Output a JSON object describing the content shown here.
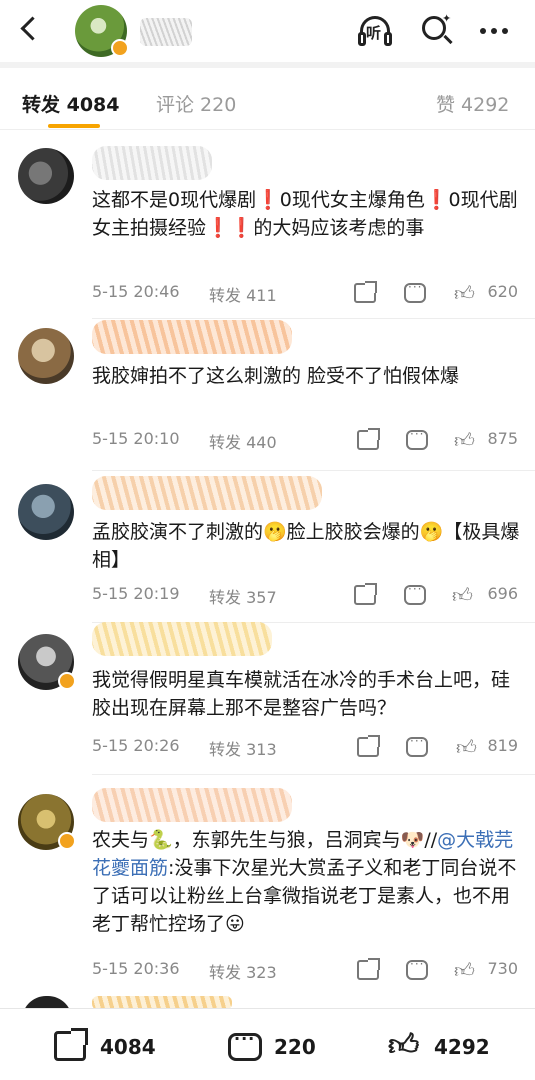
{
  "header": {
    "listen_label": "听"
  },
  "tabs": [
    {
      "label": "转发 4084"
    },
    {
      "label": "评论 220"
    },
    {
      "label": "赞 4292"
    }
  ],
  "comments": [
    {
      "text": "这都不是0现代爆剧❗0现代女主爆角色❗0现代剧女主拍摄经验❗❗的大妈应该考虑的事",
      "time": "5-15 20:46",
      "forward": "转发 411",
      "likes": "620"
    },
    {
      "text": "我胶婶拍不了这么刺激的 脸受不了怕假体爆",
      "time": "5-15 20:10",
      "forward": "转发 440",
      "likes": "875"
    },
    {
      "text": "孟胶胶演不了刺激的🫢脸上胶胶会爆的🫢【极具爆相】",
      "time": "5-15 20:19",
      "forward": "转发 357",
      "likes": "696"
    },
    {
      "text": "我觉得假明星真车模就活在冰冷的手术台上吧，硅胶出现在屏幕上那不是整容广告吗？",
      "time": "5-15 20:26",
      "forward": "转发 313",
      "likes": "819"
    },
    {
      "text_before": "农夫与🐍，东郭先生与狼，吕洞宾与🐶//",
      "mention": "@大戟芫花夔面筋",
      "text_after": ":没事下次星光大赏孟子义和老丁同台说不了话可以让粉丝上台拿微指说老丁是素人，也不用老丁帮忙控场了😛",
      "time": "5-15 20:36",
      "forward": "转发 323",
      "likes": "730"
    }
  ],
  "bottom_bar": {
    "share_count": "4084",
    "comment_count": "220",
    "like_count": "4292"
  },
  "colors": {
    "accent": "#f7a400",
    "mention": "#3c6fb6",
    "meta_text": "#888888"
  }
}
